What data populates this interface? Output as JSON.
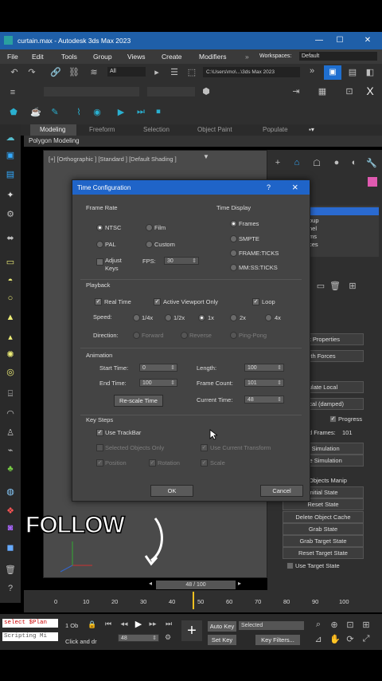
{
  "window": {
    "title": "curtain.max - Autodesk 3ds Max 2023"
  },
  "menu": [
    "File",
    "Edit",
    "Tools",
    "Group",
    "Views",
    "Create",
    "Modifiers"
  ],
  "workspaces": {
    "label": "Workspaces:",
    "value": "Default"
  },
  "toolbar": {
    "filter": "All",
    "path": "C:\\Users\\mo\\...\\3ds Max 2023"
  },
  "ribbon": {
    "tabs": [
      "Modeling",
      "Freeform",
      "Selection",
      "Object Paint",
      "Populate"
    ],
    "active_panel": "Polygon Modeling"
  },
  "viewport": {
    "label": "[+] [Orthographic ] [Standard ] [Default Shading ]"
  },
  "dialog": {
    "title": "Time Configuration",
    "help": "?",
    "close": "×",
    "frame_rate": {
      "label": "Frame Rate",
      "ntsc": "NTSC",
      "film": "Film",
      "pal": "PAL",
      "custom": "Custom",
      "adjust_keys": "Adjust Keys",
      "fps_label": "FPS:",
      "fps": "30"
    },
    "time_display": {
      "label": "Time Display",
      "frames": "Frames",
      "smpte": "SMPTE",
      "frame_ticks": "FRAME:TICKS",
      "mmss_ticks": "MM:SS:TICKS"
    },
    "playback": {
      "label": "Playback",
      "real_time": "Real Time",
      "active_viewport": "Active Viewport Only",
      "loop": "Loop",
      "speed_label": "Speed:",
      "speeds": [
        "1/4x",
        "1/2x",
        "1x",
        "2x",
        "4x"
      ],
      "direction_label": "Direction:",
      "directions": [
        "Forward",
        "Reverse",
        "Ping-Pong"
      ]
    },
    "animation": {
      "label": "Animation",
      "start_label": "Start Time:",
      "start": "0",
      "end_label": "End Time:",
      "end": "100",
      "length_label": "Length:",
      "length": "100",
      "frame_count_label": "Frame Count:",
      "frame_count": "101",
      "current_label": "Current Time:",
      "current": "48",
      "rescale": "Re-scale Time"
    },
    "key_steps": {
      "label": "Key Steps",
      "use_trackbar": "Use TrackBar",
      "selected_only": "Selected Objects Only",
      "use_current": "Use Current Transform",
      "position": "Position",
      "rotation": "Rotation",
      "scale": "Scale"
    },
    "ok": "OK",
    "cancel": "Cancel"
  },
  "right_panel": {
    "list": [
      "oup",
      "hel",
      "ms",
      "ces"
    ],
    "buttons": [
      "ct Properties",
      "th Forces",
      "ulate Local",
      "Local (damped)",
      "e Simulation",
      "ete Simulation"
    ],
    "progress": "Progress",
    "frames": "d Frames:",
    "frames_value": "101",
    "manip_label": "Objects Manip",
    "manip_buttons": [
      "Initial State",
      "Reset State",
      "Delete Object Cache",
      "Grab State",
      "Grab Target State",
      "Reset Target State"
    ],
    "use_target": "Use Target State"
  },
  "overlay": {
    "text": "FOLLOW"
  },
  "timeline": {
    "slider": "48 / 100",
    "ticks": [
      "0",
      "10",
      "20",
      "30",
      "40",
      "50",
      "60",
      "70",
      "80",
      "90",
      "100"
    ]
  },
  "status": {
    "script1": "select $Plan",
    "script2": "Scripting Mi",
    "hint": "Click and dr",
    "objects": "1 Ob",
    "frame": "48",
    "auto_key": "Auto Key",
    "selected": "Selected",
    "set_key": "Set Key",
    "key_filters": "Key Filters..."
  }
}
